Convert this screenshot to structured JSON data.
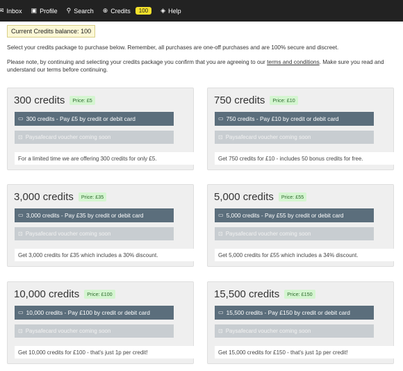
{
  "nav": {
    "items": [
      {
        "label": "Inbox",
        "icon": "envelope-icon"
      },
      {
        "label": "Profile",
        "icon": "id-card-icon"
      },
      {
        "label": "Search",
        "icon": "search-icon"
      },
      {
        "label": "Credits",
        "icon": "plus-circle-icon"
      },
      {
        "label": "Help",
        "icon": "help-icon"
      }
    ],
    "credits_badge": "100"
  },
  "balance": {
    "label": "Current Credits balance:",
    "value": "100"
  },
  "intro": "Select your credits package to purchase below. Remember, all purchases are one-off purchases and are 100% secure and discreet.",
  "note": {
    "before": "Please note, by continuing and selecting your credits package you confirm that you are agreeing to our ",
    "link": "terms and conditions",
    "after": ". Make sure you read and understand our terms before continuing."
  },
  "packages": [
    {
      "title": "300 credits",
      "price": "Price: £5",
      "pay_label": "300 credits - Pay £5 by credit or debit card",
      "voucher_label": "Paysafecard voucher coming soon",
      "description": "For a limited time we are offering 300 credits for only £5."
    },
    {
      "title": "750 credits",
      "price": "Price: £10",
      "pay_label": "750 credits - Pay £10 by credit or debit card",
      "voucher_label": "Paysafecard voucher coming soon",
      "description": "Get 750 credits for £10 - includes 50 bonus credits for free."
    },
    {
      "title": "3,000 credits",
      "price": "Price: £35",
      "pay_label": "3,000 credits - Pay £35 by credit or debit card",
      "voucher_label": "Paysafecard voucher coming soon",
      "description": "Get 3,000 credits for £35 which includes a 30% discount."
    },
    {
      "title": "5,000 credits",
      "price": "Price: £55",
      "pay_label": "5,000 credits - Pay £55 by credit or debit card",
      "voucher_label": "Paysafecard voucher coming soon",
      "description": "Get 5,000 credits for £55 which includes a 34% discount."
    },
    {
      "title": "10,000 credits",
      "price": "Price: £100",
      "pay_label": "10,000 credits - Pay £100 by credit or debit card",
      "voucher_label": "Paysafecard voucher coming soon",
      "description": "Get 10,000 credits for £100 - that's just 1p per credit!"
    },
    {
      "title": "15,500 credits",
      "price": "Price: £150",
      "pay_label": "15,500 credits - Pay £150 by credit or debit card",
      "voucher_label": "Paysafecard voucher coming soon",
      "description": "Get 15,000 credits for £150 - that's just 1p per credit!"
    }
  ],
  "colors": {
    "nav_bg": "#222222",
    "badge_bg": "#f5e12b",
    "pay_button_bg": "#5b6e7c",
    "voucher_button_bg": "#c8cdd1",
    "price_tag_bg": "#d4f5d0",
    "balance_bg": "#fcf8d6"
  }
}
